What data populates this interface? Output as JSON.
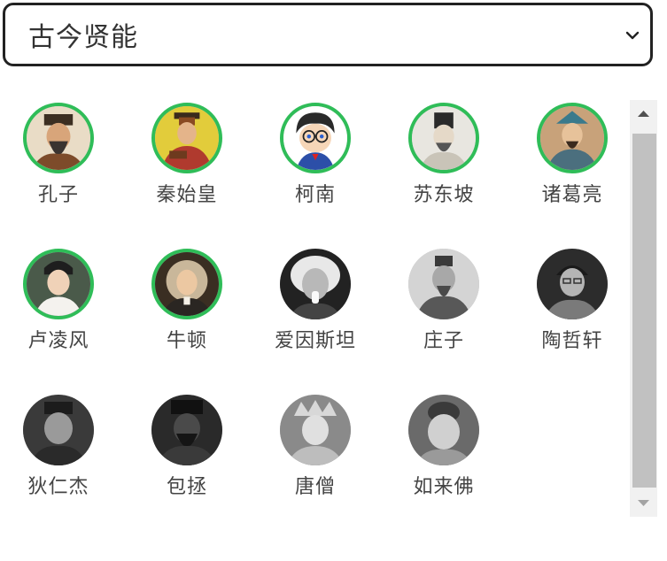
{
  "selector": {
    "selected": "古今贤能",
    "icon": "chevron-down-icon"
  },
  "people": [
    {
      "name": "孔子",
      "selected": true
    },
    {
      "name": "秦始皇",
      "selected": true
    },
    {
      "name": "柯南",
      "selected": true
    },
    {
      "name": "苏东坡",
      "selected": true
    },
    {
      "name": "诸葛亮",
      "selected": true
    },
    {
      "name": "卢凌风",
      "selected": true
    },
    {
      "name": "牛顿",
      "selected": true
    },
    {
      "name": "爱因斯坦",
      "selected": false
    },
    {
      "name": "庄子",
      "selected": false
    },
    {
      "name": "陶哲轩",
      "selected": false
    },
    {
      "name": "狄仁杰",
      "selected": false
    },
    {
      "name": "包拯",
      "selected": false
    },
    {
      "name": "唐僧",
      "selected": false
    },
    {
      "name": "如来佛",
      "selected": false
    }
  ],
  "colors": {
    "selected_border": "#2fbd58",
    "scroll_track": "#f1f1f1",
    "scroll_thumb": "#c1c1c1"
  }
}
